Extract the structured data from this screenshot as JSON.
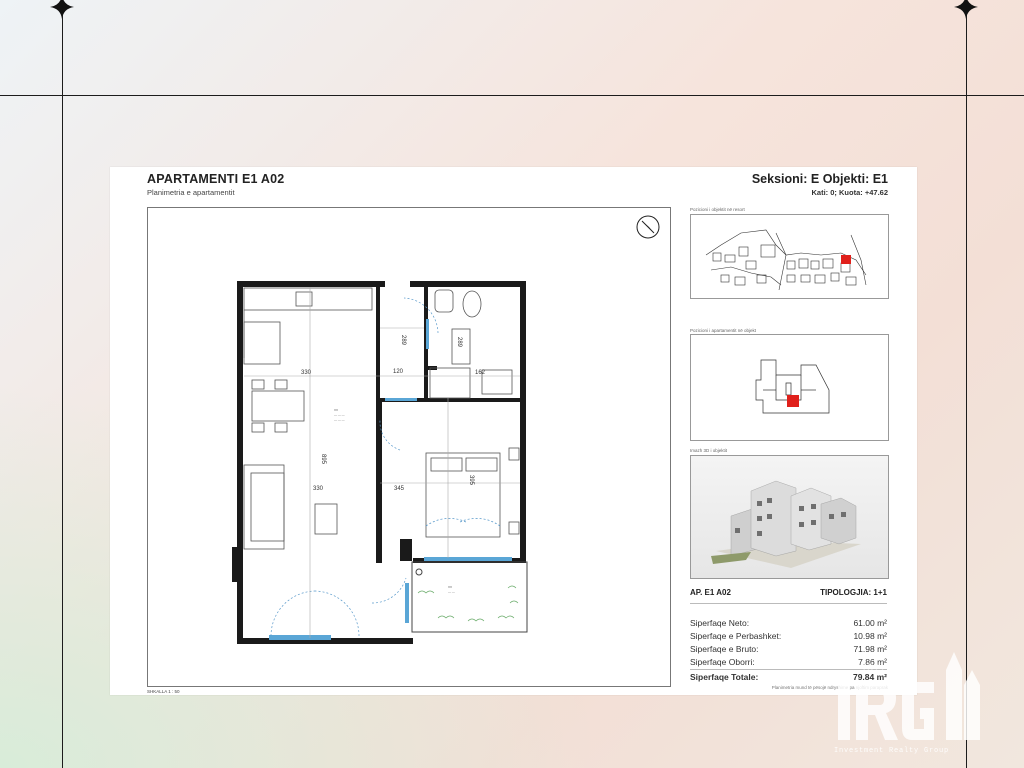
{
  "sheet": {
    "title": "APARTAMENTI E1 A02",
    "subtitle": "Planimetria e apartamentit",
    "section_title": "Seksioni: E Objekti: E1",
    "floor_level": "Kati: 0; Kuota: +47.62",
    "scale": "SHKALLA    1 : 50",
    "note": "Planimetria mund të pësojë ndryshime pa njoftim paraprak"
  },
  "plan": {
    "dims": {
      "d330_top": "330",
      "d120": "120",
      "d162": "162",
      "d289a": "289",
      "d289b": "289",
      "d895": "895",
      "d330_mid": "330",
      "d345": "345",
      "d395": "395"
    }
  },
  "panels": {
    "cap1": "Pozicioni i objektit në resort",
    "cap2": "Pozicioni i apartamentit në objekt",
    "cap3": "Imazh 3D i objektit"
  },
  "info": {
    "apartment_code": "AP. E1 A02",
    "typology": "TIPOLOGJIA: 1+1",
    "rows": [
      {
        "label": "Siperfaqe Neto:",
        "value": "61.00 m²"
      },
      {
        "label": "Siperfaqe e Perbashket:",
        "value": "10.98 m²"
      },
      {
        "label": "Siperfaqe e Bruto:",
        "value": "71.98 m²"
      },
      {
        "label": "Siperfaqe Oborri:",
        "value": "7.86 m²"
      }
    ],
    "total_label": "Siperfaqe Totale:",
    "total_value": "79.84 m²"
  },
  "brand": {
    "logo_text": "IRG",
    "tagline": "Investment Realty Group"
  },
  "colors": {
    "highlight": "#e0201b",
    "wall": "#1a1a1a",
    "window": "#5aa6d6"
  }
}
